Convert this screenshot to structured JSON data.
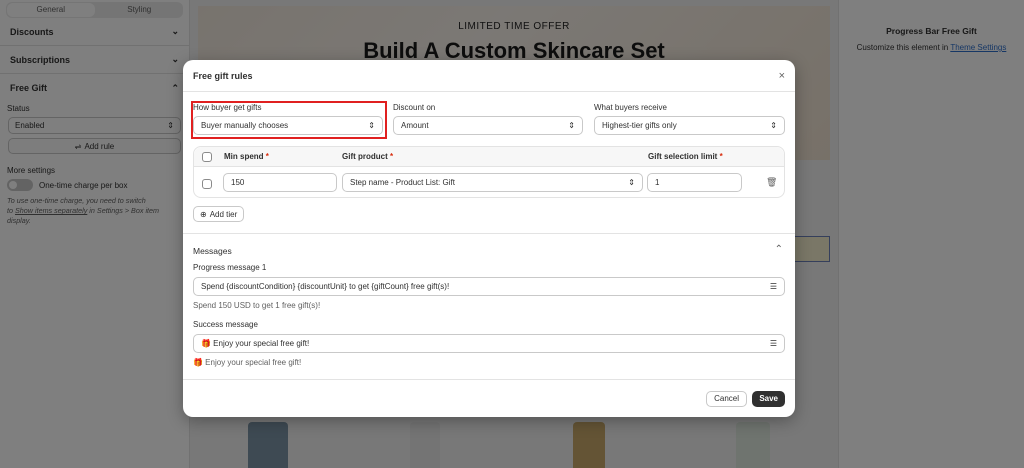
{
  "sidebar": {
    "tabs": [
      "General",
      "Styling"
    ],
    "sections": {
      "discounts": "Discounts",
      "subscriptions": "Subscriptions",
      "free_gift": "Free Gift"
    },
    "status_label": "Status",
    "status_value": "Enabled",
    "add_rule": "Add rule",
    "more_settings": "More settings",
    "toggle_label": "One-time charge per box",
    "help_1": "To use one-time charge, you need to switch",
    "help_2_pre": "to ",
    "help_2_link": "Show items separately",
    "help_2_post": " in Settings > Box item",
    "help_3": "display."
  },
  "preview": {
    "offer": "LIMITED TIME OFFER",
    "headline": "Build A Custom Skincare Set"
  },
  "right_panel": {
    "title": "Progress Bar Free Gift",
    "sub_pre": "Customize this element in ",
    "sub_link": "Theme Settings"
  },
  "modal": {
    "title": "Free gift rules",
    "close": "×",
    "how_label": "How buyer get gifts",
    "how_value": "Buyer manually chooses",
    "discount_label": "Discount on",
    "discount_value": "Amount",
    "receive_label": "What buyers receive",
    "receive_value": "Highest-tier gifts only",
    "table": {
      "col_min": "Min spend",
      "col_product": "Gift product",
      "col_limit": "Gift selection limit",
      "req": "*",
      "row_min": "150",
      "row_product": "Step name - Product List: Gift",
      "row_limit": "1"
    },
    "add_tier": "Add tier",
    "messages_title": "Messages",
    "progress_label": "Progress message 1",
    "progress_value": "Spend {discountCondition} {discountUnit} to get {giftCount} free gift(s)!",
    "progress_preview": "Spend 150 USD to get 1 free gift(s)!",
    "success_label": "Success message",
    "success_value": "🎁 Enjoy your special free gift!",
    "success_preview": "🎁 Enjoy your special free gift!",
    "cancel": "Cancel",
    "save": "Save"
  },
  "icons": {
    "chevron_down": "⌄",
    "chevron_up": "⌃",
    "select_caret": "⇕",
    "plus_circle": "⊕",
    "trash": "🗑",
    "list": "☰"
  }
}
